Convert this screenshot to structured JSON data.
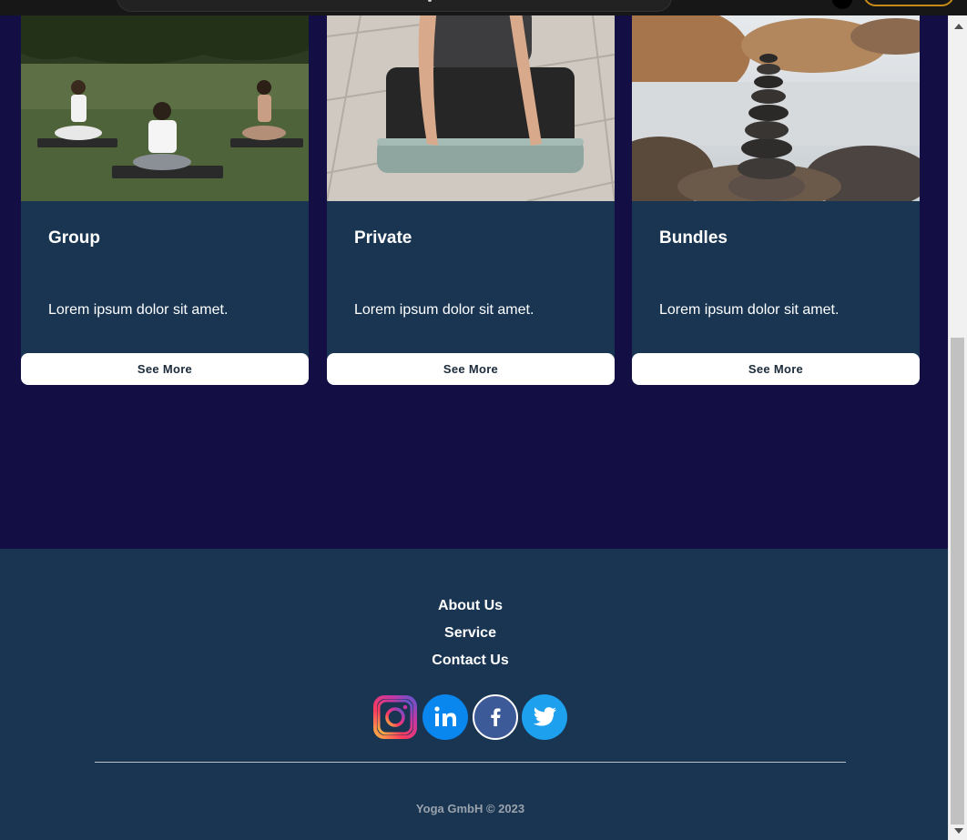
{
  "cards": [
    {
      "title": "Group",
      "description": "Lorem ipsum dolor sit amet.",
      "button": "See More",
      "image": "group-meditation-photo"
    },
    {
      "title": "Private",
      "description": "Lorem ipsum dolor sit amet.",
      "button": "See More",
      "image": "yoga-mat-photo"
    },
    {
      "title": "Bundles",
      "description": "Lorem ipsum dolor sit amet.",
      "button": "See More",
      "image": "stone-stack-photo"
    }
  ],
  "footer": {
    "links": [
      "About Us",
      "Service",
      "Contact Us"
    ],
    "socials": [
      "instagram-icon",
      "linkedin-icon",
      "facebook-icon",
      "twitter-icon"
    ],
    "copyright": "Yoga GmbH © 2023"
  },
  "colors": {
    "background": "#130f45",
    "card_body": "#193552",
    "footer": "#193552",
    "accent": "#c88a17"
  }
}
